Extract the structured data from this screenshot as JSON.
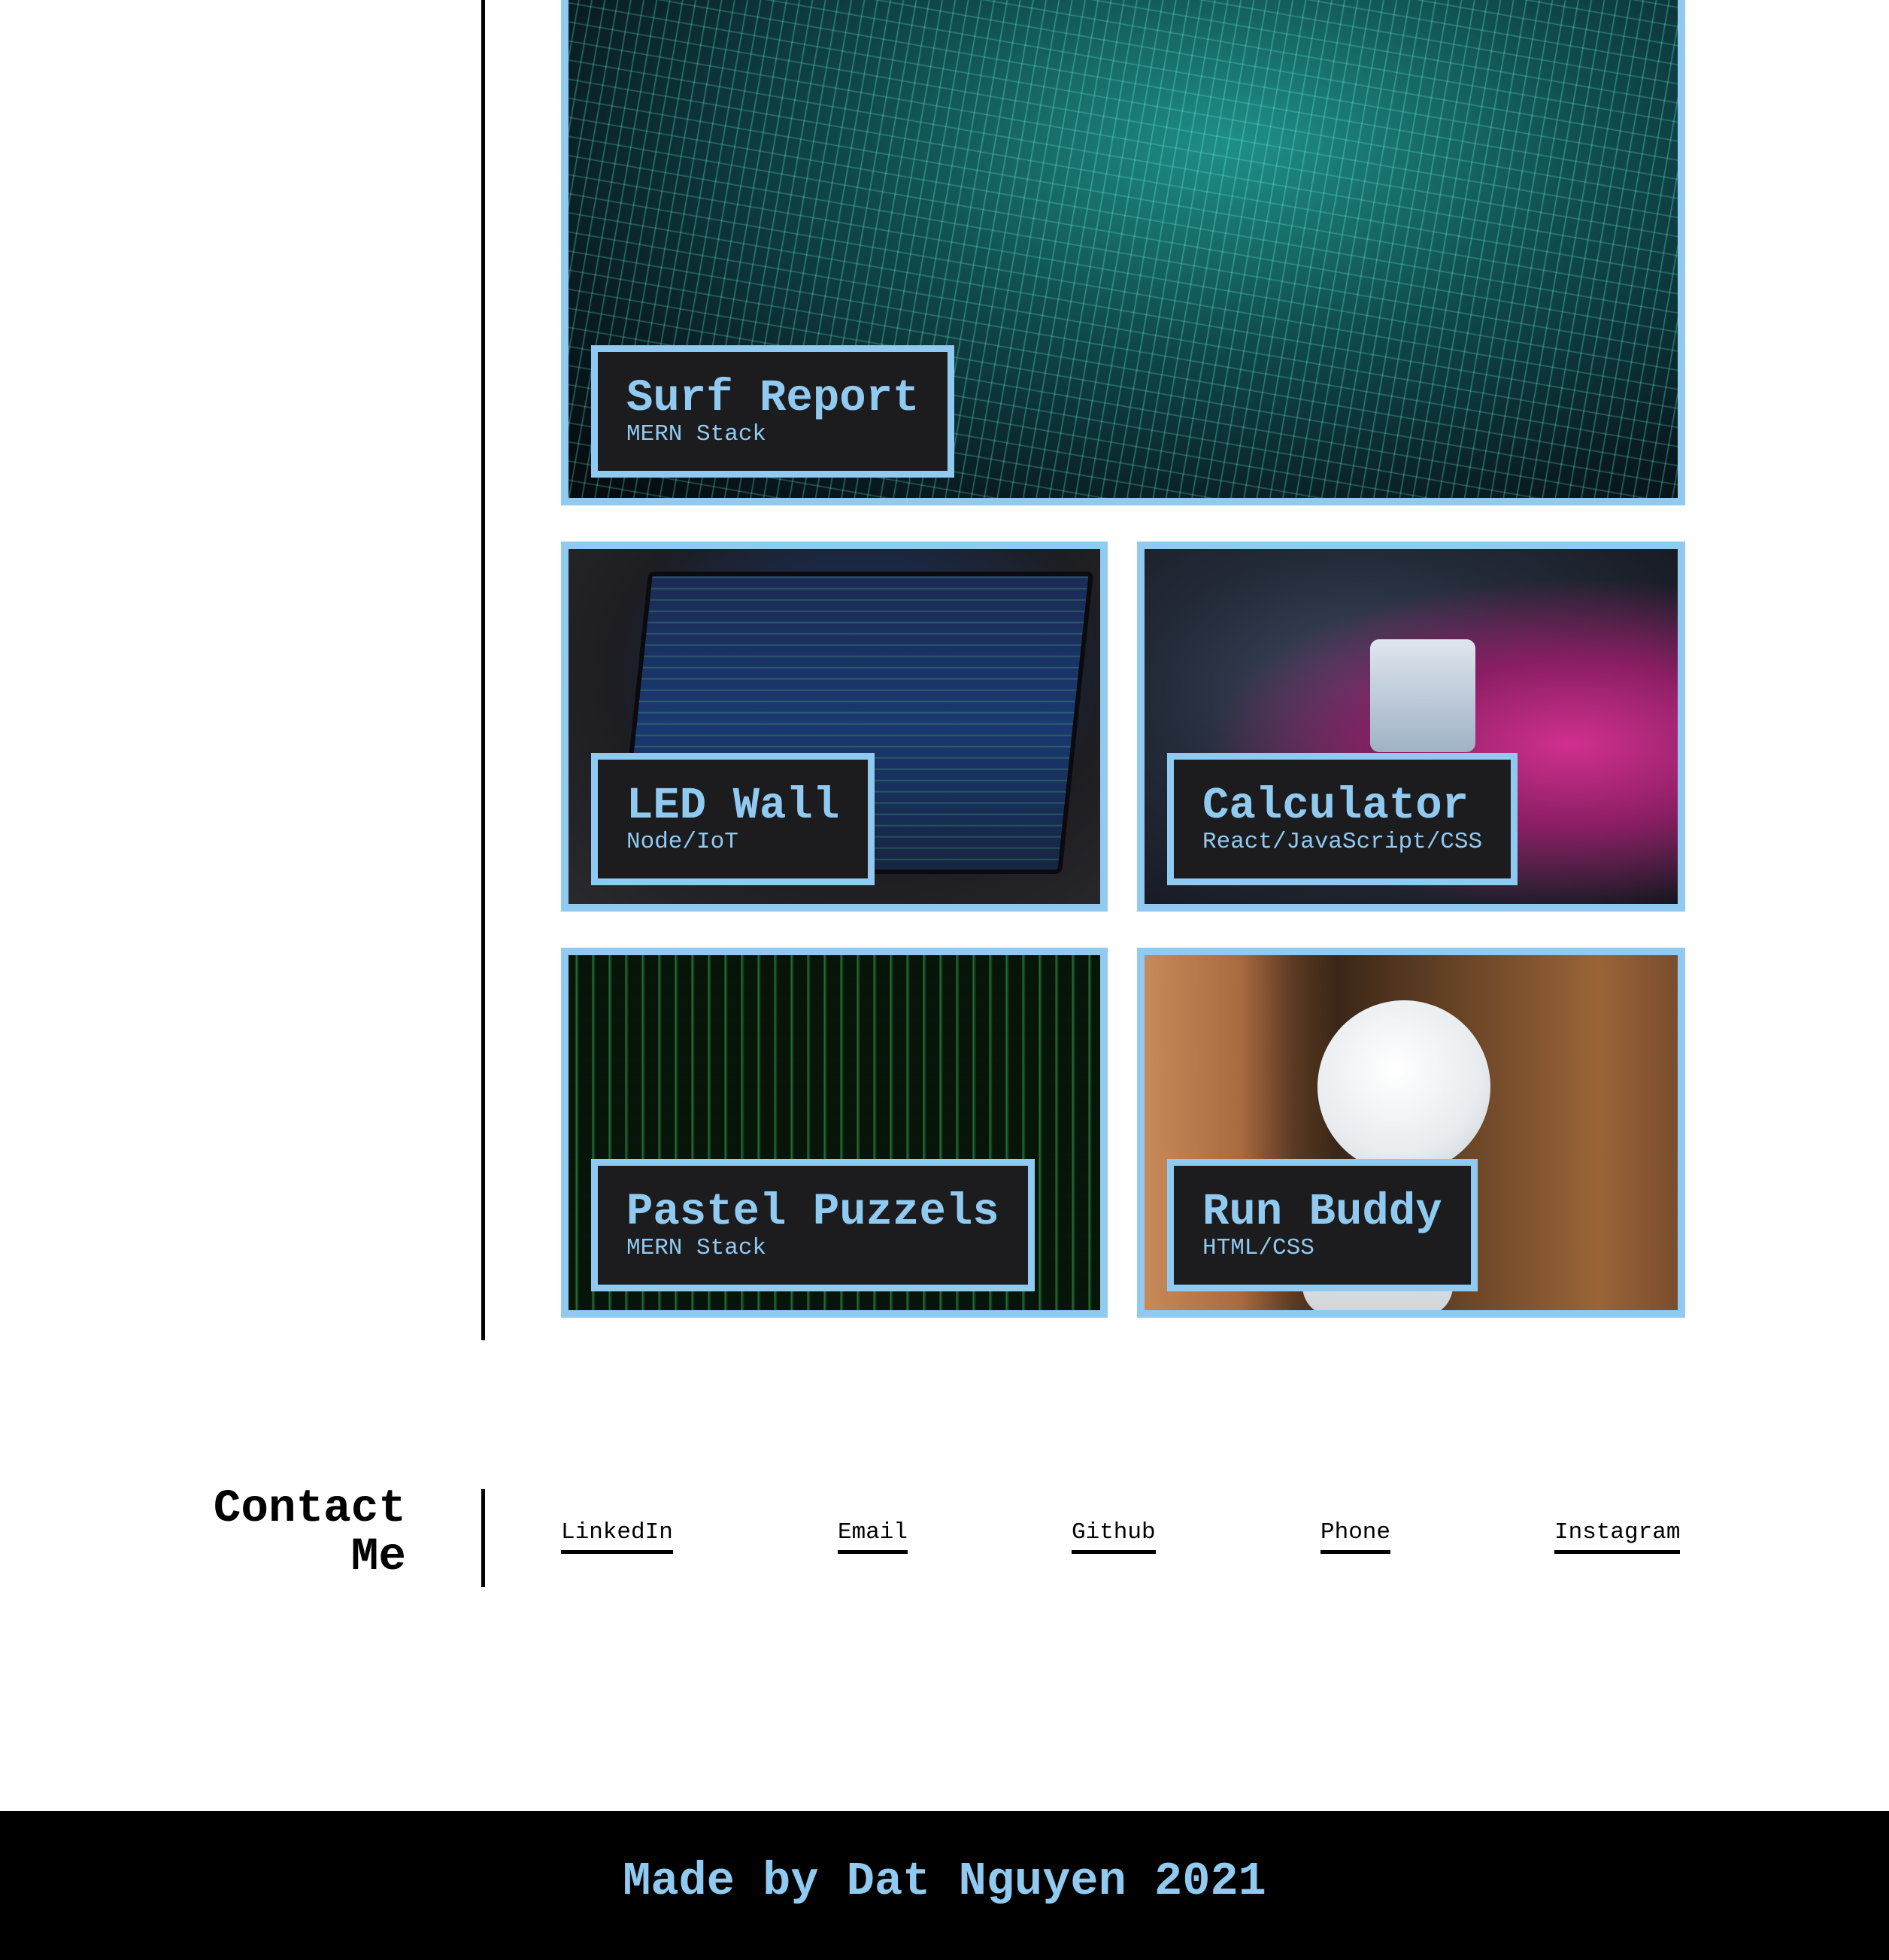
{
  "projects": [
    {
      "title": "Surf Report",
      "stack": "MERN Stack",
      "image": "circuit-board-image"
    },
    {
      "title": "LED Wall",
      "stack": "Node/IoT",
      "image": "laptop-code-image"
    },
    {
      "title": "Calculator",
      "stack": "React/JavaScript/CSS",
      "image": "retro-consoles-image"
    },
    {
      "title": "Pastel Puzzels",
      "stack": "MERN Stack",
      "image": "matrix-code-image"
    },
    {
      "title": "Run Buddy",
      "stack": "HTML/CSS",
      "image": "robot-image"
    }
  ],
  "contact": {
    "heading_line1": "Contact",
    "heading_line2": "Me",
    "links": [
      "LinkedIn",
      "Email",
      "Github",
      "Phone",
      "Instagram"
    ]
  },
  "footer": {
    "text": "Made by Dat Nguyen 2021"
  },
  "colors": {
    "accent": "#90caf0",
    "label_bg": "#1c1c1e",
    "footer_bg": "#000000"
  }
}
